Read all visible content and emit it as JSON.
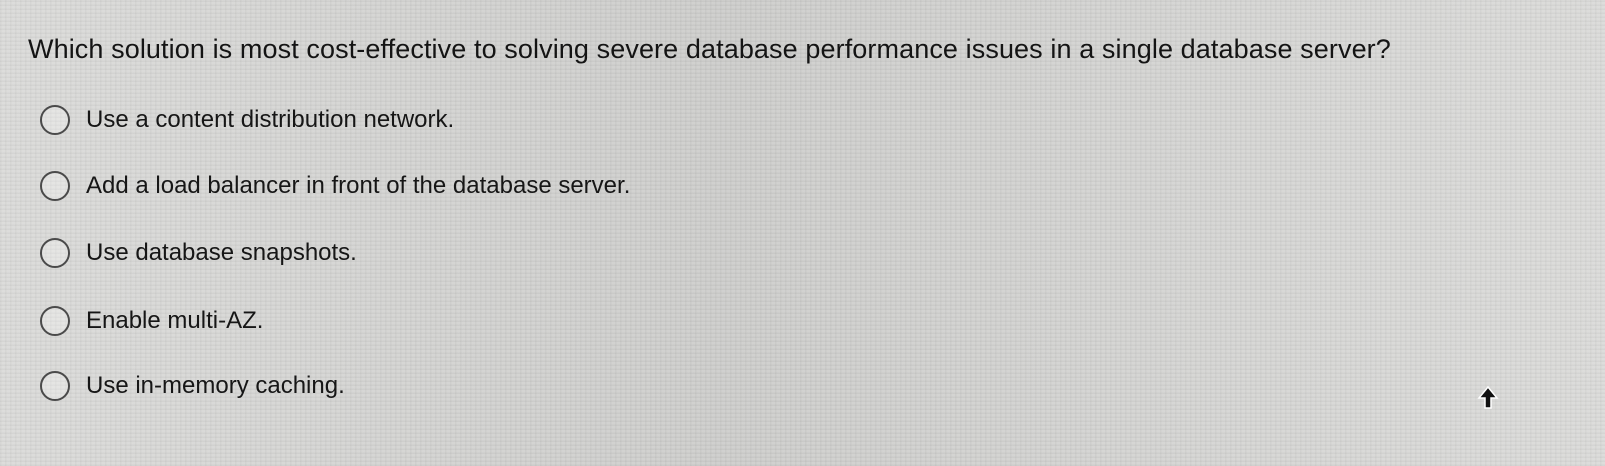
{
  "question": {
    "text": "Which solution is most cost-effective to solving severe database performance issues in a single database server?"
  },
  "options": [
    {
      "label": "Use a content distribution network.",
      "selected": false
    },
    {
      "label": "Add a load balancer in front of the database server.",
      "selected": false
    },
    {
      "label": "Use database snapshots.",
      "selected": false
    },
    {
      "label": "Enable multi-AZ.",
      "selected": false
    },
    {
      "label": "Use in-memory caching.",
      "selected": false
    }
  ],
  "icons": {
    "radio": "radio-button-icon",
    "cursor": "mouse-pointer-icon"
  },
  "colors": {
    "background": "#d7d7d5",
    "text": "#141414",
    "radio_border": "#4a4a4a"
  }
}
